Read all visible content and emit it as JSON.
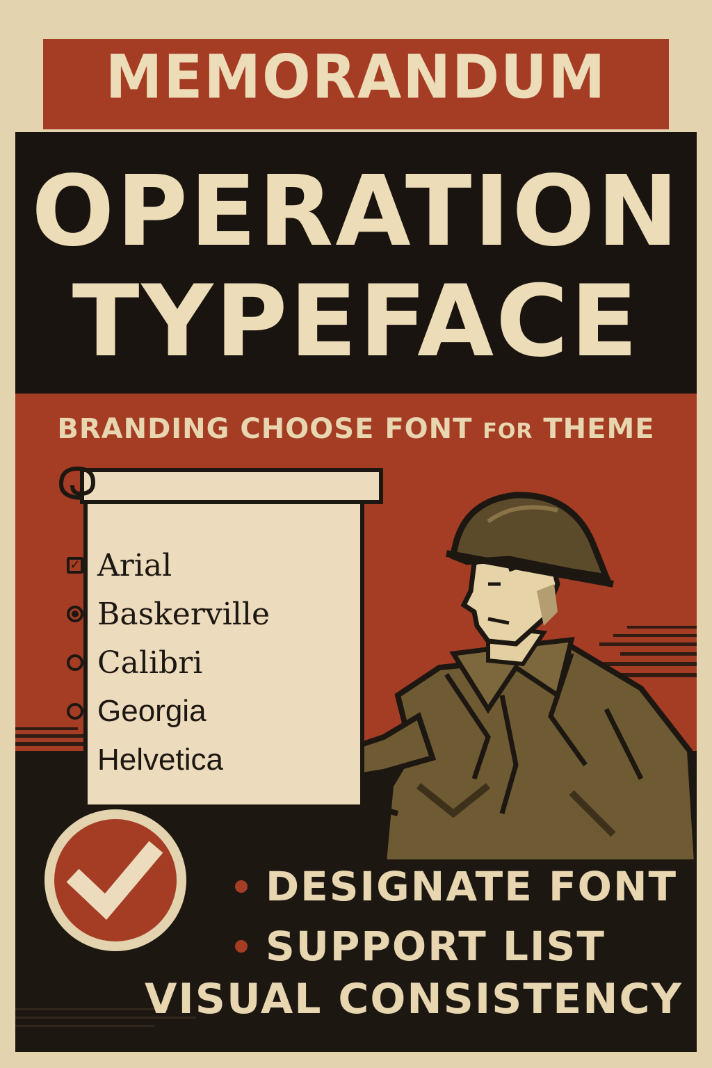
{
  "header": {
    "title": "MEMORANDUM"
  },
  "banner": {
    "line1": "OPERATION",
    "line2": "TYPEFACE"
  },
  "subtitle": {
    "part1": "BRANDING CHOOSE FONT",
    "part2": "FOR",
    "part3": "THEME"
  },
  "font_options": [
    {
      "label": "Arial",
      "state": "checked",
      "style": "serif"
    },
    {
      "label": "Baskerville",
      "state": "selected",
      "style": "serif"
    },
    {
      "label": "Calibri",
      "state": "unselected",
      "style": "serif"
    },
    {
      "label": "Georgia",
      "state": "unselected",
      "style": "sans"
    },
    {
      "label": "Helvetica",
      "state": "unselected",
      "style": "sans"
    }
  ],
  "bullets": [
    {
      "label": "DESIGNATE FONT"
    },
    {
      "label": "SUPPORT LIST"
    }
  ],
  "closing": {
    "label": "VISUAL CONSISTENCY"
  },
  "colors": {
    "cream": "#e3d3ae",
    "rust": "#a53d25",
    "black": "#191410",
    "olive": "#6e5a33"
  },
  "icons": {
    "scroll": "scroll-icon",
    "check": "check-badge-icon",
    "soldier": "soldier-illustration"
  }
}
